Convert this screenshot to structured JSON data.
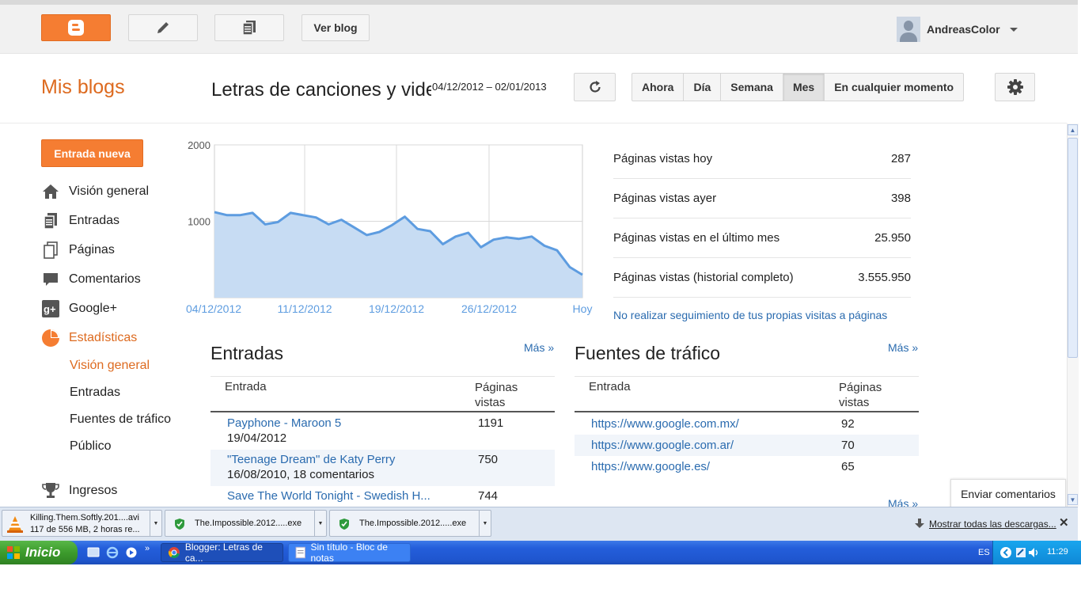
{
  "topbar": {
    "view_blog_label": "Ver blog",
    "username": "AndreasColor"
  },
  "header": {
    "my_blogs": "Mis blogs",
    "blog_title": "Letras de canciones y videos",
    "date_range": "04/12/2012 – 02/01/2013",
    "ranges": [
      {
        "label": "Ahora",
        "active": false
      },
      {
        "label": "Día",
        "active": false
      },
      {
        "label": "Semana",
        "active": false
      },
      {
        "label": "Mes",
        "active": true
      },
      {
        "label": "En cualquier momento",
        "active": false
      }
    ]
  },
  "sidebar": {
    "new_post_label": "Entrada nueva",
    "items": [
      {
        "label": "Visión general",
        "icon": "home-icon"
      },
      {
        "label": "Entradas",
        "icon": "posts-icon"
      },
      {
        "label": "Páginas",
        "icon": "pages-icon"
      },
      {
        "label": "Comentarios",
        "icon": "comment-icon"
      },
      {
        "label": "Google+",
        "icon": "google-plus-icon"
      },
      {
        "label": "Estadísticas",
        "icon": "stats-pie-icon"
      }
    ],
    "sub_items": [
      "Visión general",
      "Entradas",
      "Fuentes de tráfico",
      "Público"
    ],
    "earnings_label": "Ingresos",
    "accent_color": "#dd6a1f"
  },
  "chart_data": {
    "type": "area",
    "x_tick_labels": [
      "04/12/2012",
      "11/12/2012",
      "19/12/2012",
      "26/12/2012",
      "Hoy"
    ],
    "yticks": [
      1000,
      2000
    ],
    "ylim": [
      0,
      2000
    ],
    "values": [
      1120,
      1080,
      1080,
      1110,
      960,
      990,
      1110,
      1080,
      1050,
      960,
      1020,
      920,
      820,
      860,
      950,
      1060,
      900,
      870,
      700,
      800,
      850,
      660,
      760,
      790,
      770,
      800,
      680,
      620,
      400,
      300
    ],
    "color": "#5d9ce0",
    "fill": "#c7dcf3"
  },
  "stats": [
    {
      "label": "Páginas vistas hoy",
      "value": "287"
    },
    {
      "label": "Páginas vistas ayer",
      "value": "398"
    },
    {
      "label": "Páginas vistas en el último mes",
      "value": "25.950"
    },
    {
      "label": "Páginas vistas (historial completo)",
      "value": "3.555.950"
    }
  ],
  "no_track_label": "No realizar seguimiento de tus propias visitas a páginas",
  "posts": {
    "title": "Entradas",
    "more": "Más »",
    "col_entry": "Entrada",
    "col_views": "Páginas vistas",
    "rows": [
      {
        "title": "Payphone - Maroon 5",
        "sub": "19/04/2012",
        "views": "1191"
      },
      {
        "title": "\"Teenage Dream\" de Katy Perry",
        "sub": "16/08/2010, 18 comentarios",
        "views": "750"
      },
      {
        "title": "Save The World Tonight - Swedish H...",
        "sub": "",
        "views": "744"
      }
    ]
  },
  "traffic": {
    "title": "Fuentes de tráfico",
    "more": "Más »",
    "col_entry": "Entrada",
    "col_views": "Páginas vistas",
    "rows": [
      {
        "url": "https://www.google.com.mx/",
        "views": "92"
      },
      {
        "url": "https://www.google.com.ar/",
        "views": "70"
      },
      {
        "url": "https://www.google.es/",
        "views": "65"
      }
    ]
  },
  "public_more": "Más »",
  "feedback_label": "Enviar comentarios",
  "downloads": {
    "items": [
      {
        "name": "Killing.Them.Softly.201....avi",
        "status": "117 de 556 MB, 2 horas re..."
      },
      {
        "name": "The.Impossible.2012.....exe",
        "status": ""
      },
      {
        "name": "The.Impossible.2012.....exe",
        "status": ""
      }
    ],
    "show_all": "Mostrar todas las descargas..."
  },
  "taskbar": {
    "start_label": "Inicio",
    "tasks": [
      "Blogger: Letras de ca...",
      "Sin título - Bloc de notas"
    ],
    "lang": "ES",
    "clock": "11:29"
  }
}
